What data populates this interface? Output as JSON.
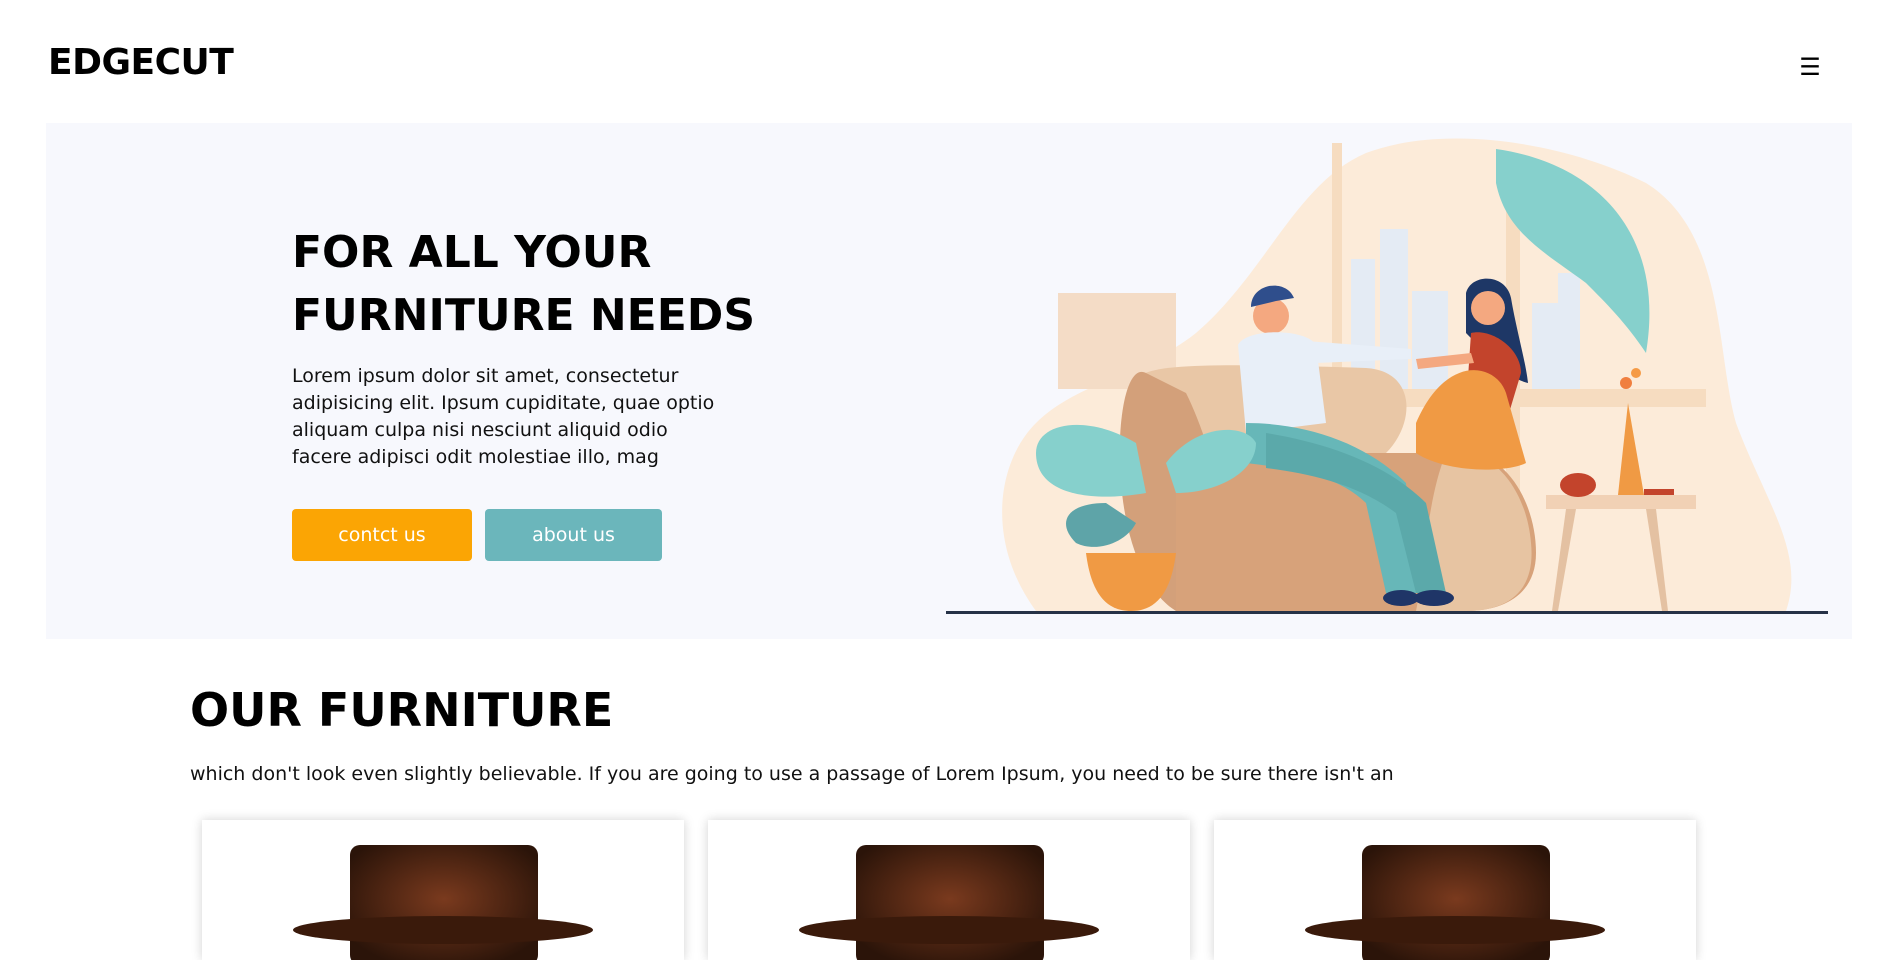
{
  "brand": {
    "name": "EDGECUT"
  },
  "header": {
    "menu_icon": "hamburger-menu-icon",
    "menu_glyph": "☰"
  },
  "hero": {
    "title_line1": "FOR ALL YOUR",
    "title_line2": "FURNITURE NEEDS",
    "text": "Lorem ipsum dolor sit amet, consectetur adipisicing elit. Ipsum cupiditate, quae optio aliquam culpa nisi nesciunt aliquid odio facere adipisci odit molestiae illo, mag",
    "buttons": {
      "contact": "contct us",
      "about": "about us"
    },
    "colors": {
      "contact": "#fba504",
      "about": "#6bb6bb",
      "background": "#f7f8fd"
    }
  },
  "furniture": {
    "title": "OUR FURNITURE",
    "text": "which don't look even slightly believable. If you are going to use a passage of Lorem Ipsum, you need to be sure there isn't an",
    "cards": [
      {
        "image": "leather-chair-image"
      },
      {
        "image": "leather-chair-image"
      },
      {
        "image": "leather-chair-image"
      }
    ]
  }
}
